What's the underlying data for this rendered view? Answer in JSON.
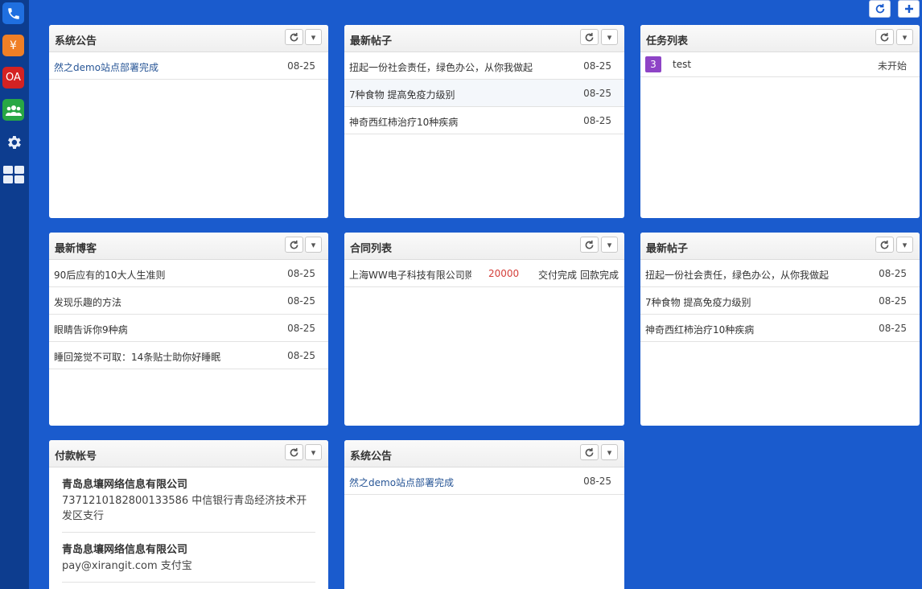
{
  "sidebar": {
    "items": [
      {
        "name": "phone",
        "color": "#1f6fe0",
        "label": ""
      },
      {
        "name": "finance",
        "color": "#f07f26",
        "label": "¥"
      },
      {
        "name": "oa",
        "color": "#d42222",
        "label": "OA"
      },
      {
        "name": "users",
        "color": "#28a745",
        "label": ""
      },
      {
        "name": "settings",
        "color": "transparent",
        "label": ""
      },
      {
        "name": "apps",
        "color": "transparent",
        "label": ""
      }
    ]
  },
  "panels": {
    "p1": {
      "title": "系统公告",
      "rows": [
        {
          "text": "然之demo站点部署完成",
          "date": "08-25"
        }
      ]
    },
    "p2": {
      "title": "最新帖子",
      "rows": [
        {
          "text": "扭起一份社会责任，绿色办公，从你我做起",
          "date": "08-25"
        },
        {
          "text": "7种食物 提高免疫力级别",
          "date": "08-25"
        },
        {
          "text": "神奇西红柿治疗10种疾病",
          "date": "08-25"
        }
      ]
    },
    "p3": {
      "title": "任务列表",
      "tasks": [
        {
          "badge": "3",
          "name": "test",
          "status": "未开始"
        }
      ]
    },
    "p4": {
      "title": "最新博客",
      "rows": [
        {
          "text": "90后应有的10大人生准则",
          "date": "08-25"
        },
        {
          "text": "发现乐趣的方法",
          "date": "08-25"
        },
        {
          "text": "眼睛告诉你9种病",
          "date": "08-25"
        },
        {
          "text": "睡回笼觉不可取：14条贴士助你好睡眠",
          "date": "08-25"
        }
      ]
    },
    "p5": {
      "title": "合同列表",
      "contracts": [
        {
          "name": "上海WW电子科技有限公司购",
          "amount": "20000",
          "delivery": "交付完成",
          "payment": "回款完成"
        }
      ]
    },
    "p6": {
      "title": "最新帖子",
      "rows": [
        {
          "text": "扭起一份社会责任，绿色办公，从你我做起",
          "date": "08-25"
        },
        {
          "text": "7种食物 提高免疫力级别",
          "date": "08-25"
        },
        {
          "text": "神奇西红柿治疗10种疾病",
          "date": "08-25"
        }
      ]
    },
    "p7": {
      "title": "付款帐号",
      "accounts": [
        {
          "name": "青岛息壤网络信息有限公司",
          "detail": "7371210182800133586 中信银行青岛经济技术开发区支行"
        },
        {
          "name": "青岛息壤网络信息有限公司",
          "detail": "pay@xirangit.com 支付宝"
        }
      ]
    },
    "p8": {
      "title": "系统公告",
      "rows": [
        {
          "text": "然之demo站点部署完成",
          "date": "08-25"
        }
      ]
    }
  },
  "toolbar": {
    "refresh_icon": "refresh-icon",
    "add_icon": "plus-icon"
  },
  "colors": {
    "background": "#1a5bcd",
    "sidebar": "#0d3d8f",
    "link": "#275596",
    "amount": "#d43f3a",
    "task_badge": "#8e44c6"
  }
}
